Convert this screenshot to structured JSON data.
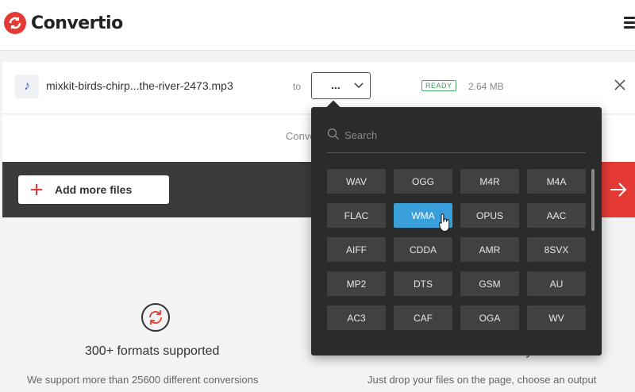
{
  "header": {
    "logo_text": "Convertio"
  },
  "file": {
    "name": "mixkit-birds-chirp...the-river-2473.mp3",
    "to_label": "to",
    "selected_format": "...",
    "status": "READY",
    "size": "2.64 MB"
  },
  "convert_row": {
    "text": "Conve"
  },
  "actions": {
    "add_files_label": "Add more files"
  },
  "features": [
    {
      "title": "300+ formats supported",
      "desc": "We support more than 25600 different conversions"
    },
    {
      "title": "Fast and easy",
      "desc": "Just drop your files on the page, choose an output"
    }
  ],
  "dropdown": {
    "search_placeholder": "Search",
    "selected": "WMA",
    "formats": [
      "WAV",
      "OGG",
      "M4R",
      "M4A",
      "FLAC",
      "WMA",
      "OPUS",
      "AAC",
      "AIFF",
      "CDDA",
      "AMR",
      "8SVX",
      "MP2",
      "DTS",
      "GSM",
      "AU",
      "AC3",
      "CAF",
      "OGA",
      "WV"
    ]
  },
  "colors": {
    "accent_red": "#e53935",
    "selected_blue": "#3aa0dc",
    "dark_panel": "#2b2b2b"
  }
}
